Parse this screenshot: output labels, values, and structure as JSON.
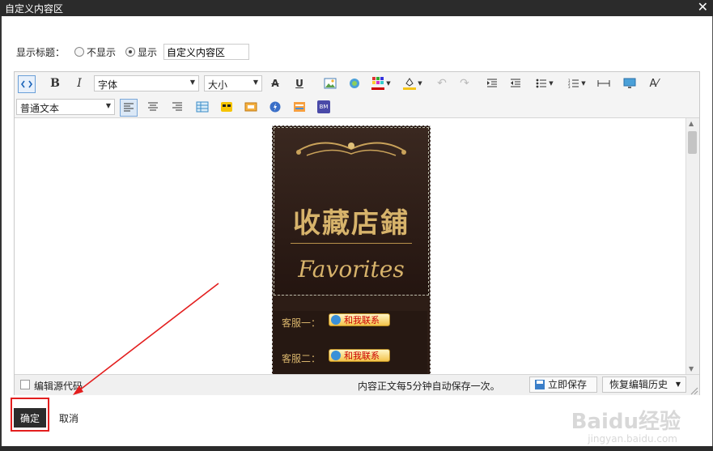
{
  "window": {
    "title": "自定义内容区",
    "close_symbol": "✕"
  },
  "title_row": {
    "label": "显示标题：",
    "option_hide": "不显示",
    "option_show": "显示",
    "title_value": "自定义内容区"
  },
  "toolbar": {
    "font_family": "字体",
    "font_size": "大小",
    "paragraph_format": "普通文本",
    "bold": "B",
    "italic": "I",
    "underline": "U",
    "strike": "A",
    "bm_label": "BM"
  },
  "content": {
    "banner_title": "收藏店鋪",
    "banner_subtitle": "Favorites",
    "service_1": "客服一：",
    "service_2": "客服二：",
    "contact_button": "和我联系"
  },
  "statusbar": {
    "source_code_label": "编辑源代码",
    "autosave_text": "内容正文每5分钟自动保存一次。",
    "save_now": "立即保存",
    "restore_history": "恢复编辑历史"
  },
  "footer": {
    "ok_button": "确定",
    "cancel_button": "取消"
  },
  "watermark": {
    "brand": "Baidu经验",
    "url": "jingyan.baidu.com"
  },
  "colors": {
    "titlebar": "#2b2b2b",
    "ok_button": "#2c2c2c",
    "highlight": "#e31e1e",
    "banner_gold": "#d7b36b"
  }
}
